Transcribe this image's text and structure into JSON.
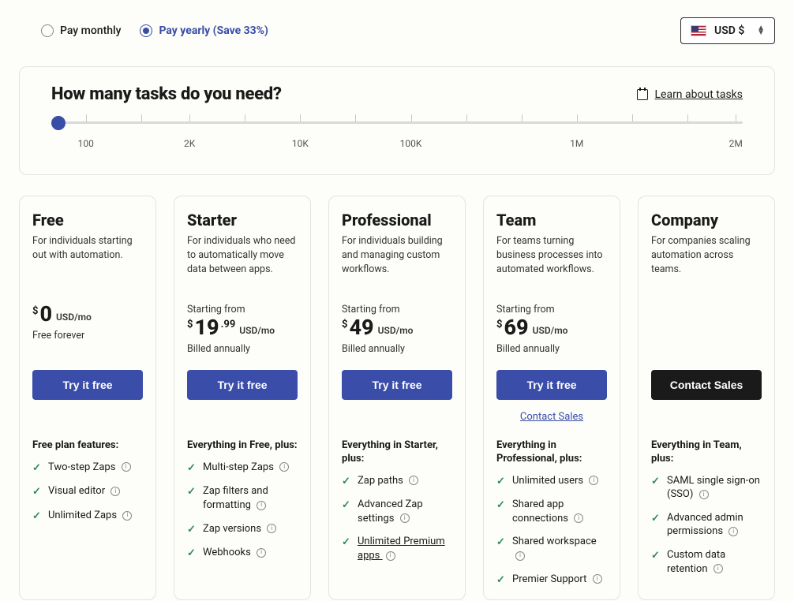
{
  "billing": {
    "monthly_label": "Pay monthly",
    "yearly_label": "Pay yearly (Save 33%)"
  },
  "currency": {
    "label": "USD $"
  },
  "tasks": {
    "title": "How many tasks do you need?",
    "learn_label": "Learn about tasks",
    "tick_labels": [
      "100",
      "2K",
      "10K",
      "100K",
      "1M",
      "2M"
    ]
  },
  "plans": [
    {
      "name": "Free",
      "desc": "For individuals starting out with automation.",
      "starting_from": "",
      "currency": "$",
      "price_main": "0",
      "price_cents": "",
      "unit": "USD/mo",
      "billing_note": "Free forever",
      "cta": "Try it free",
      "cta_style": "primary",
      "secondary_link": "",
      "features_heading": "Free plan features:",
      "features": [
        {
          "text": "Two-step Zaps",
          "info": true
        },
        {
          "text": "Visual editor",
          "info": true
        },
        {
          "text": "Unlimited Zaps",
          "info": true
        }
      ]
    },
    {
      "name": "Starter",
      "desc": "For individuals who need to automatically move data between apps.",
      "starting_from": "Starting from",
      "currency": "$",
      "price_main": "19",
      "price_cents": ".99",
      "unit": "USD/mo",
      "billing_note": "Billed annually",
      "cta": "Try it free",
      "cta_style": "primary",
      "secondary_link": "",
      "features_heading": "Everything in Free, plus:",
      "features": [
        {
          "text": "Multi-step Zaps",
          "info": true
        },
        {
          "text": "Zap filters and formatting",
          "info": true
        },
        {
          "text": "Zap versions",
          "info": true
        },
        {
          "text": "Webhooks",
          "info": true
        }
      ]
    },
    {
      "name": "Professional",
      "desc": "For individuals building and managing custom workflows.",
      "starting_from": "Starting from",
      "currency": "$",
      "price_main": "49",
      "price_cents": "",
      "unit": "USD/mo",
      "billing_note": "Billed annually",
      "cta": "Try it free",
      "cta_style": "primary",
      "secondary_link": "",
      "features_heading": "Everything in Starter, plus:",
      "features": [
        {
          "text": "Zap paths",
          "info": true
        },
        {
          "text": "Advanced Zap settings",
          "info": true
        },
        {
          "text": "Unlimited Premium apps",
          "info": true,
          "underline": true
        }
      ]
    },
    {
      "name": "Team",
      "desc": "For teams turning business processes into automated workflows.",
      "starting_from": "Starting from",
      "currency": "$",
      "price_main": "69",
      "price_cents": "",
      "unit": "USD/mo",
      "billing_note": "Billed annually",
      "cta": "Try it free",
      "cta_style": "primary",
      "secondary_link": "Contact Sales",
      "features_heading": "Everything in Professional, plus:",
      "features": [
        {
          "text": "Unlimited users",
          "info": true
        },
        {
          "text": "Shared app connections",
          "info": true
        },
        {
          "text": "Shared workspace",
          "info": true
        },
        {
          "text": "Premier Support",
          "info": true
        }
      ]
    },
    {
      "name": "Company",
      "desc": "For companies scaling automation across teams.",
      "starting_from": "",
      "currency": "",
      "price_main": "",
      "price_cents": "",
      "unit": "",
      "billing_note": "",
      "cta": "Contact Sales",
      "cta_style": "dark",
      "secondary_link": "",
      "features_heading": "Everything in Team, plus:",
      "features": [
        {
          "text": "SAML single sign-on (SSO)",
          "info": true
        },
        {
          "text": "Advanced admin permissions",
          "info": true
        },
        {
          "text": "Custom data retention",
          "info": true
        }
      ]
    }
  ]
}
